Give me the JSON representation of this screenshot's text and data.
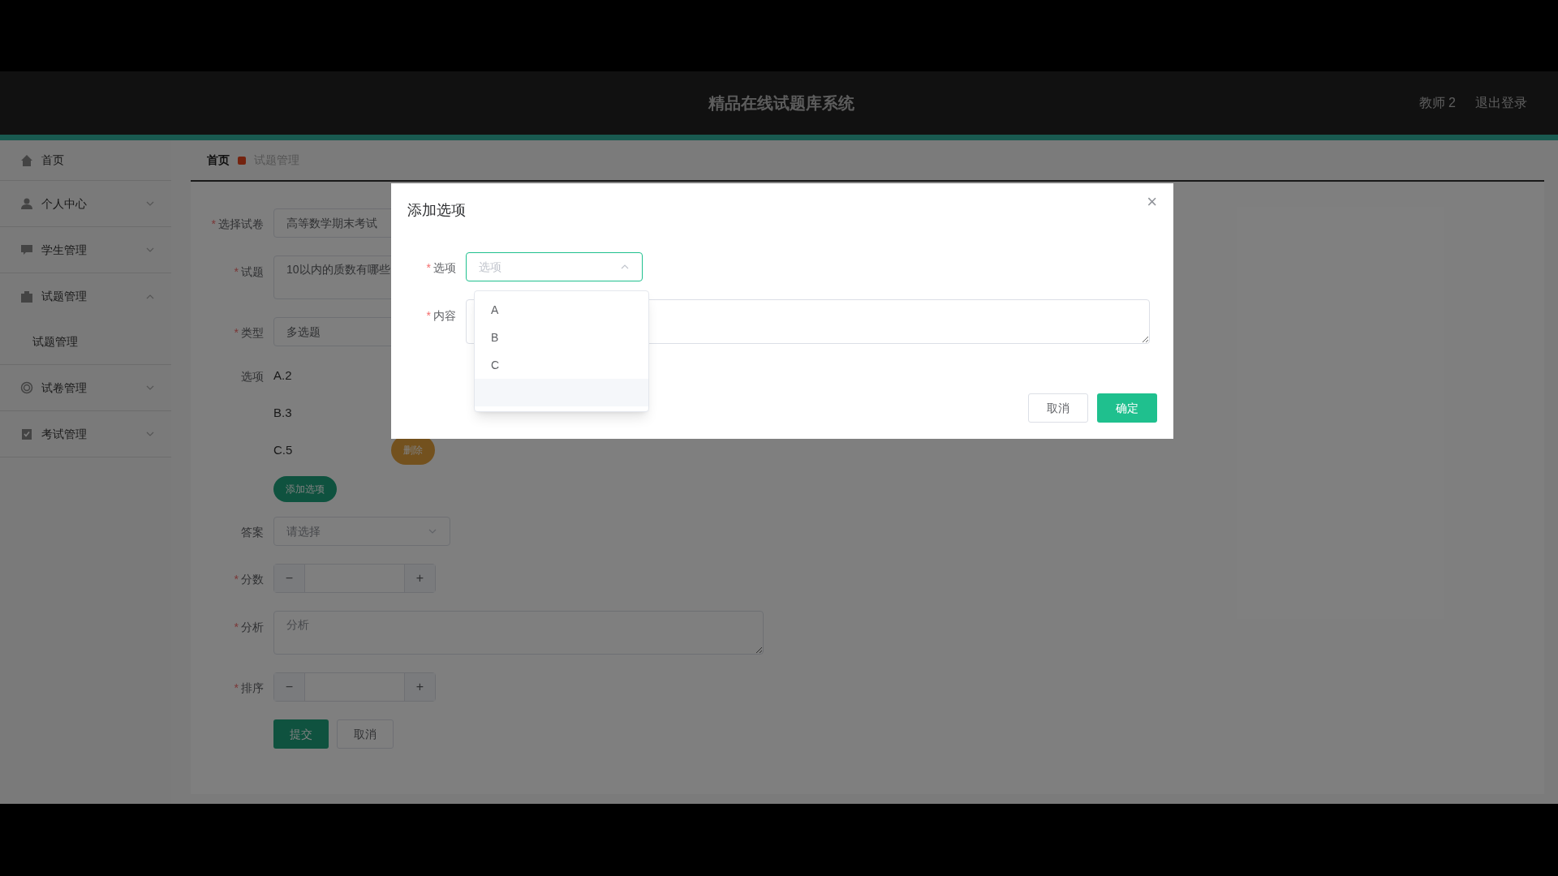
{
  "header": {
    "title": "精品在线试题库系统",
    "user": "教师 2",
    "logout": "退出登录"
  },
  "sidebar": {
    "items": [
      {
        "label": "首页",
        "kind": "link"
      },
      {
        "label": "个人中心",
        "kind": "menu",
        "expanded": false
      },
      {
        "label": "学生管理",
        "kind": "menu",
        "expanded": false
      },
      {
        "label": "试题管理",
        "kind": "menu",
        "expanded": true,
        "children": [
          {
            "label": "试题管理"
          }
        ]
      },
      {
        "label": "试卷管理",
        "kind": "menu",
        "expanded": false
      },
      {
        "label": "考试管理",
        "kind": "menu",
        "expanded": false
      }
    ]
  },
  "breadcrumb": [
    "首页",
    "试题管理"
  ],
  "form": {
    "fields": [
      {
        "kind": "select",
        "label": "选择试卷",
        "required_mark": "*",
        "value": "高等数学期末考试"
      },
      {
        "kind": "textarea",
        "label": "试题",
        "required_mark": "*",
        "value": "10以内的质数有哪些"
      },
      {
        "kind": "select",
        "label": "类型",
        "required_mark": "*",
        "value": "多选题"
      },
      {
        "kind": "options",
        "label": "选项",
        "items": [
          {
            "text": "A.2"
          },
          {
            "text": "B.3"
          },
          {
            "text": "C.5",
            "delete": "删除"
          }
        ],
        "add_button": "添加选项"
      },
      {
        "kind": "select",
        "label": "答案",
        "placeholder": "请选择"
      },
      {
        "kind": "number",
        "label": "分数",
        "required_mark": "*",
        "minus": "−",
        "plus": "+"
      },
      {
        "kind": "textarea",
        "label": "分析",
        "required_mark": "*",
        "placeholder": "分析"
      },
      {
        "kind": "number",
        "label": "排序",
        "required_mark": "*",
        "minus": "−",
        "plus": "+"
      }
    ],
    "buttons": [
      {
        "label": "提交",
        "kind": "primary"
      },
      {
        "label": "取消",
        "kind": "default"
      }
    ]
  },
  "dialog": {
    "title": "添加选项",
    "close": "×",
    "fields": [
      {
        "kind": "select",
        "label": "选项",
        "required_mark": "*",
        "placeholder": "选项",
        "expanded": true,
        "options": [
          "A",
          "B",
          "C"
        ]
      },
      {
        "kind": "textarea",
        "label": "内容",
        "required_mark": "*"
      }
    ],
    "buttons": [
      {
        "label": "取消",
        "kind": "default"
      },
      {
        "label": "确定",
        "kind": "primary"
      }
    ]
  }
}
